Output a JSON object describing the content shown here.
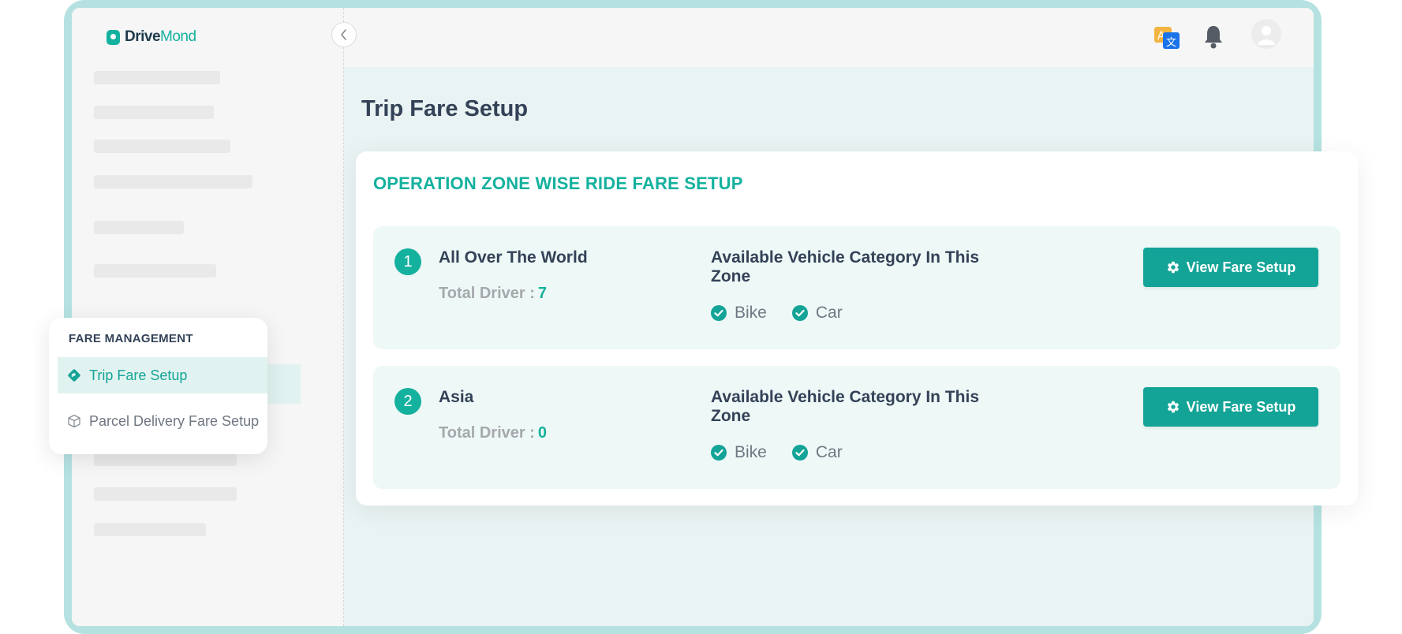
{
  "app": {
    "logo_part1": "Drive",
    "logo_part2": "Mond"
  },
  "page": {
    "title": "Trip Fare Setup"
  },
  "card": {
    "title": "OPERATION ZONE WISE RIDE FARE SETUP",
    "zones": [
      {
        "number": "1",
        "name": "All Over The World",
        "total_driver_label": "Total Driver :",
        "total_driver": "7",
        "vehicle_title": "Available Vehicle Category In This Zone",
        "vehicles": [
          "Bike",
          "Car"
        ],
        "button_label": "View Fare Setup"
      },
      {
        "number": "2",
        "name": "Asia",
        "total_driver_label": "Total Driver :",
        "total_driver": "0",
        "vehicle_title": "Available Vehicle Category In This Zone",
        "vehicles": [
          "Bike",
          "Car"
        ],
        "button_label": "View Fare Setup"
      }
    ]
  },
  "menu": {
    "heading": "FARE MANAGEMENT",
    "items": [
      {
        "label": "Trip Fare Setup",
        "active": true
      },
      {
        "label": "Parcel Delivery Fare Setup",
        "active": false
      }
    ]
  },
  "colors": {
    "brand": "#14b19e",
    "button": "#14a497",
    "text_dark": "#334257",
    "frame": "#b5e2e1"
  },
  "icons": {
    "logo": "drivemond-logo-icon",
    "collapse": "chevron-left-icon",
    "language": "translate-icon",
    "notifications": "bell-icon",
    "avatar": "user-avatar-icon",
    "check": "check-circle-icon",
    "gear": "gear-icon",
    "trip": "diamond-direction-icon",
    "parcel": "box-icon"
  }
}
